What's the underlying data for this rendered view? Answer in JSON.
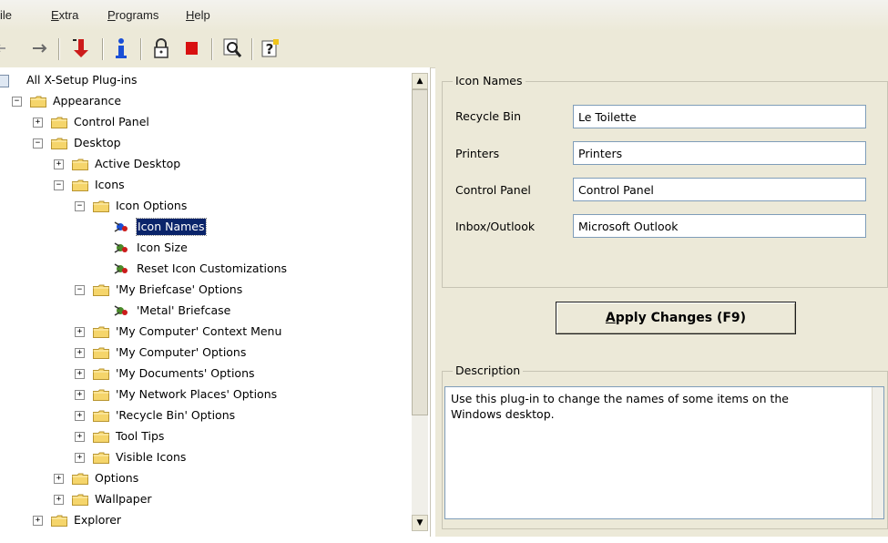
{
  "menu": {
    "items": [
      {
        "label": "ile",
        "accel": ""
      },
      {
        "label": "Extra",
        "accel": "E"
      },
      {
        "label": "Programs",
        "accel": "P"
      },
      {
        "label": "Help",
        "accel": "H"
      }
    ]
  },
  "toolbar": {
    "buttons": [
      {
        "icon": "back-arrow-icon"
      },
      {
        "icon": "forward-arrow-icon"
      },
      {
        "icon": "red-down-arrow-icon"
      },
      {
        "icon": "info-icon"
      },
      {
        "icon": "lock-icon"
      },
      {
        "icon": "red-flag-icon"
      },
      {
        "icon": "search-magnifier-icon"
      },
      {
        "icon": "help-question-icon"
      }
    ]
  },
  "tree": {
    "root_label": "All X-Setup Plug-ins",
    "nodes": [
      {
        "label": "Appearance",
        "level": 1,
        "kind": "folder",
        "expander": "−"
      },
      {
        "label": "Control Panel",
        "level": 2,
        "kind": "folder",
        "expander": "+"
      },
      {
        "label": "Desktop",
        "level": 2,
        "kind": "folder",
        "expander": "−"
      },
      {
        "label": "Active Desktop",
        "level": 3,
        "kind": "folder",
        "expander": "+"
      },
      {
        "label": "Icons",
        "level": 3,
        "kind": "folder",
        "expander": "−"
      },
      {
        "label": "Icon Options",
        "level": 4,
        "kind": "folder",
        "expander": "−"
      },
      {
        "label": "Icon Names",
        "level": 5,
        "kind": "plugin",
        "selected": true
      },
      {
        "label": "Icon Size",
        "level": 5,
        "kind": "plugin"
      },
      {
        "label": "Reset Icon Customizations",
        "level": 5,
        "kind": "plugin"
      },
      {
        "label": "'My Briefcase' Options",
        "level": 4,
        "kind": "folder",
        "expander": "−"
      },
      {
        "label": "'Metal' Briefcase",
        "level": 5,
        "kind": "plugin"
      },
      {
        "label": "'My Computer' Context Menu",
        "level": 4,
        "kind": "folder",
        "expander": "+"
      },
      {
        "label": "'My Computer' Options",
        "level": 4,
        "kind": "folder",
        "expander": "+"
      },
      {
        "label": "'My Documents' Options",
        "level": 4,
        "kind": "folder",
        "expander": "+"
      },
      {
        "label": "'My Network Places' Options",
        "level": 4,
        "kind": "folder",
        "expander": "+"
      },
      {
        "label": "'Recycle Bin' Options",
        "level": 4,
        "kind": "folder",
        "expander": "+"
      },
      {
        "label": "Tool Tips",
        "level": 4,
        "kind": "folder",
        "expander": "+"
      },
      {
        "label": "Visible Icons",
        "level": 4,
        "kind": "folder",
        "expander": "+"
      },
      {
        "label": "Options",
        "level": 3,
        "kind": "folder",
        "expander": "+"
      },
      {
        "label": "Wallpaper",
        "level": 3,
        "kind": "folder",
        "expander": "+"
      },
      {
        "label": "Explorer",
        "level": 2,
        "kind": "folder",
        "expander": "+"
      }
    ]
  },
  "icon_names": {
    "title": "Icon Names",
    "fields": [
      {
        "label": "Recycle Bin",
        "value": "Le Toilette"
      },
      {
        "label": "Printers",
        "value": "Printers"
      },
      {
        "label": "Control Panel",
        "value": "Control Panel"
      },
      {
        "label": "Inbox/Outlook",
        "value": "Microsoft Outlook"
      }
    ]
  },
  "apply_button": {
    "label": "Apply Changes (F9)"
  },
  "description": {
    "title": "Description",
    "text": "Use this plug-in to change the names of some items on the Windows desktop."
  },
  "colors": {
    "selection": "#0a246a",
    "panel": "#ece9d8",
    "input_border": "#7f9db9"
  }
}
